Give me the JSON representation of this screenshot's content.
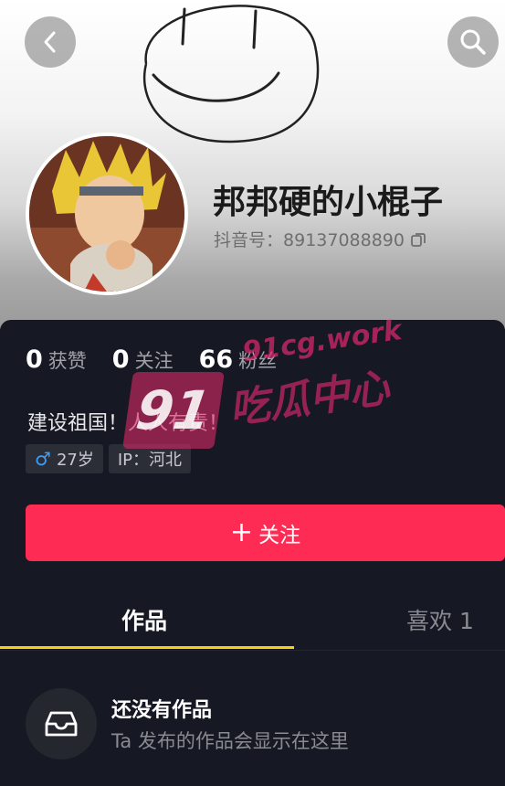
{
  "profile": {
    "nickname": "邦邦硬的小棍子",
    "douyin_id_label": "抖音号：",
    "douyin_id": "89137088890",
    "bio": "建设祖国！人人有责！"
  },
  "stats": [
    {
      "value": "0",
      "label": "获赞"
    },
    {
      "value": "0",
      "label": "关注"
    },
    {
      "value": "66",
      "label": "粉丝"
    }
  ],
  "tags": {
    "age": "27岁",
    "ip": "IP：河北"
  },
  "actions": {
    "follow_label": "关注"
  },
  "tabs": {
    "works": "作品",
    "likes": "喜欢 1"
  },
  "empty_state": {
    "title": "还没有作品",
    "subtitle": "Ta 发布的作品会显示在这里"
  },
  "watermark": {
    "number": "91",
    "domain": "91cg.work",
    "text": "吃瓜中心"
  },
  "colors": {
    "background": "#161823",
    "accent_red": "#fe2c55",
    "tab_indicator": "#face15",
    "male_blue": "#3aa0ff"
  },
  "icons": [
    "back-arrow-icon",
    "search-icon",
    "copy-icon",
    "male-icon",
    "plus-icon",
    "inbox-tray-icon"
  ]
}
